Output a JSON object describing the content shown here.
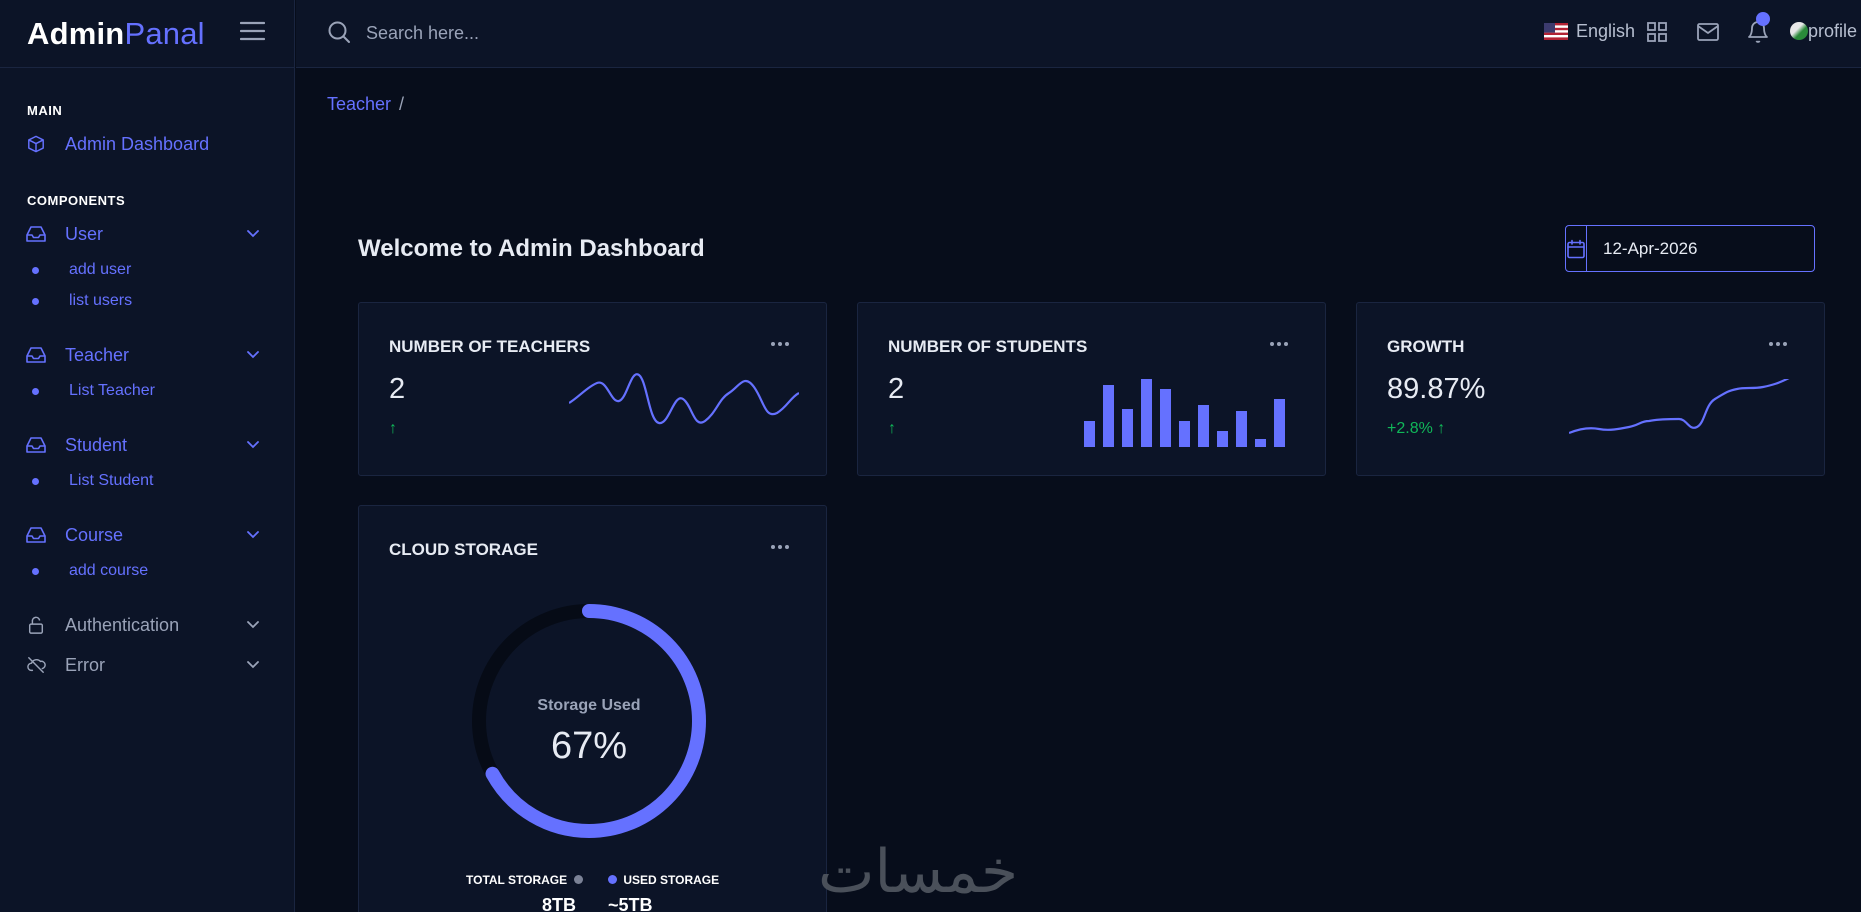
{
  "brand": {
    "part1": "Admin",
    "part2": "Panal"
  },
  "sidebar": {
    "section_main": "MAIN",
    "dashboard": "Admin Dashboard",
    "section_components": "COMPONENTS",
    "user": "User",
    "add_user": "add user",
    "list_users": "list users",
    "teacher": "Teacher",
    "list_teacher": "List Teacher",
    "student": "Student",
    "list_student": "List Student",
    "course": "Course",
    "add_course": "add course",
    "authentication": "Authentication",
    "error": "Error"
  },
  "header": {
    "search_placeholder": "Search here...",
    "language": "English",
    "profile": "profile"
  },
  "breadcrumb": {
    "item1": "Teacher",
    "sep": "/"
  },
  "main": {
    "welcome": "Welcome to Admin Dashboard",
    "date": "12-Apr-2026"
  },
  "cards": {
    "teachers": {
      "title": "NUMBER OF TEACHERS",
      "value": "2",
      "delta": "↑"
    },
    "students": {
      "title": "NUMBER OF STUDENTS",
      "value": "2",
      "delta": "↑"
    },
    "growth": {
      "title": "GROWTH",
      "value": "89.87%",
      "delta": "+2.8% ↑"
    },
    "storage": {
      "title": "CLOUD STORAGE",
      "center_label": "Storage Used",
      "percent_text": "67%",
      "percent": 67,
      "total_label": "TOTAL STORAGE",
      "total_value": "8TB",
      "used_label": "USED STORAGE",
      "used_value": "~5TB"
    }
  },
  "colors": {
    "accent": "#6571ff",
    "success": "#10b759",
    "background": "#070d1b",
    "card": "#0c1427"
  },
  "icons": {
    "menu": "hamburger-icon",
    "search": "search-icon",
    "apps": "grid-icon",
    "mail": "mail-icon",
    "notifications": "bell-icon",
    "calendar": "calendar-icon"
  },
  "watermark": "خمسات"
}
